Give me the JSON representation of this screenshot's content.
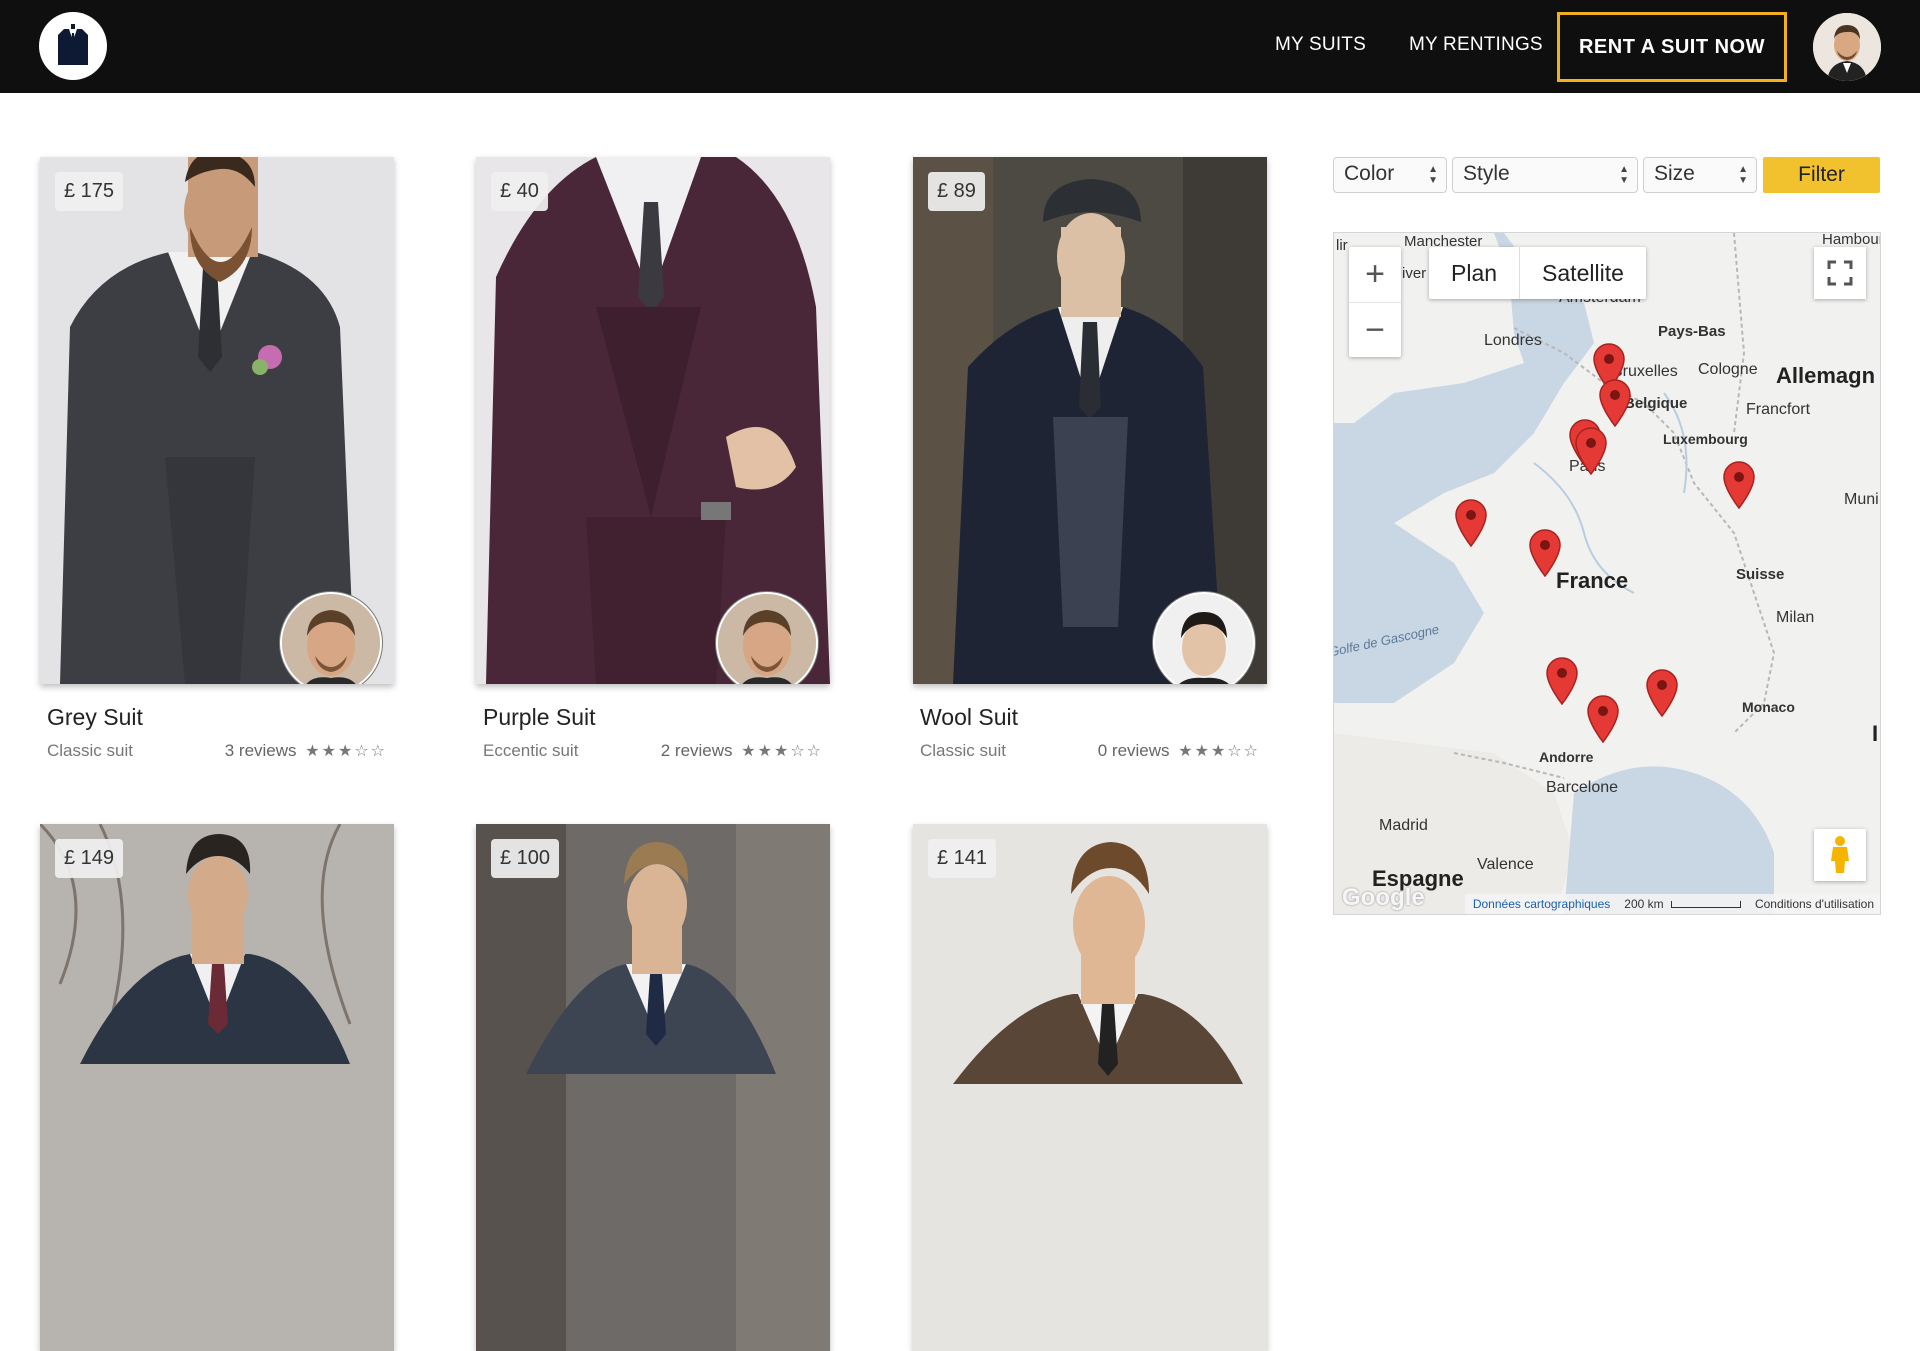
{
  "header": {
    "nav": [
      "MY SUITS",
      "MY RENTINGS"
    ],
    "cta": "RENT A SUIT NOW"
  },
  "cards": [
    {
      "price": "£ 175",
      "title": "Grey Suit",
      "subtitle": "Classic suit",
      "reviews": "3 reviews",
      "rating": 3,
      "stars": "★★★☆☆"
    },
    {
      "price": "£ 40",
      "title": "Purple Suit",
      "subtitle": "Eccentic suit",
      "reviews": "2 reviews",
      "rating": 3,
      "stars": "★★★☆☆"
    },
    {
      "price": "£ 89",
      "title": "Wool Suit",
      "subtitle": "Classic suit",
      "reviews": "0 reviews",
      "rating": 3,
      "stars": "★★★☆☆"
    },
    {
      "price": "£ 149"
    },
    {
      "price": "£ 100"
    },
    {
      "price": "£ 141"
    }
  ],
  "filters": {
    "color": "Color",
    "style": "Style",
    "size": "Size",
    "button": "Filter"
  },
  "map": {
    "map_type": [
      "Plan",
      "Satellite"
    ],
    "labels": {
      "manchester": "Manchester",
      "liv": "lir",
      "liv2": "iver",
      "hamburg": "Hambourg",
      "amsterdam": "Amsterdam",
      "paysbas": "Pays-Bas",
      "londres": "Londres",
      "bruxelles": "Bruxelles",
      "cologne": "Cologne",
      "allemagne": "Allemagn",
      "belgique": "Belgique",
      "francfort": "Francfort",
      "luxembourg": "Luxembourg",
      "paris": "Paris",
      "munich": "Muni",
      "france": "France",
      "suisse": "Suisse",
      "milan": "Milan",
      "golfe": "Golfe de Gascogne",
      "monaco": "Monaco",
      "andorre": "Andorre",
      "barcelone": "Barcelone",
      "madrid": "Madrid",
      "valence": "Valence",
      "espagne": "Espagne",
      "i": "I"
    },
    "footer": {
      "logo": "Google",
      "data": "Données cartographiques",
      "scale": "200 km",
      "terms": "Conditions d'utilisation"
    },
    "pin_color": "#e53935"
  },
  "colors": {
    "accent": "#f2c12e",
    "topbar": "#0f0f0f"
  }
}
